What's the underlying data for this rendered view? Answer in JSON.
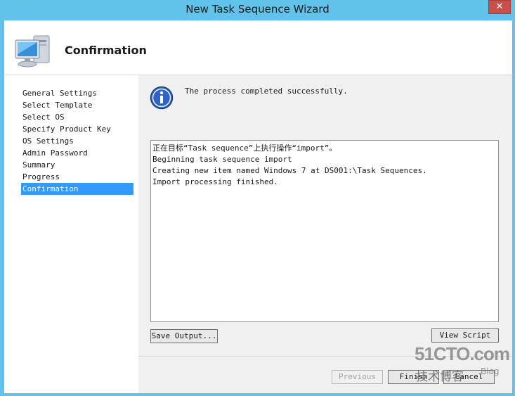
{
  "window": {
    "title": "New Task Sequence Wizard",
    "close_label": "✕"
  },
  "header": {
    "title": "Confirmation",
    "icon": "computer-icon"
  },
  "sidebar": {
    "items": [
      {
        "label": "General Settings",
        "selected": false
      },
      {
        "label": "Select Template",
        "selected": false
      },
      {
        "label": "Select OS",
        "selected": false
      },
      {
        "label": "Specify Product Key",
        "selected": false
      },
      {
        "label": "OS Settings",
        "selected": false
      },
      {
        "label": "Admin Password",
        "selected": false
      },
      {
        "label": "Summary",
        "selected": false
      },
      {
        "label": "Progress",
        "selected": false
      },
      {
        "label": "Confirmation",
        "selected": true
      }
    ]
  },
  "main": {
    "status_message": "The process completed successfully.",
    "status_icon": "info-icon",
    "log_lines": [
      "正在目标“Task sequence”上执行操作“import”。",
      "Beginning task sequence import",
      "Creating new item named Windows 7 at DS001:\\Task Sequences.",
      "Import processing finished."
    ],
    "save_output_label": "Save Output...",
    "view_script_label": "View Script"
  },
  "footer": {
    "previous_label": "Previous",
    "finish_label": "Finish",
    "cancel_label": "Cancel"
  },
  "watermark": {
    "main": "51CTO.com",
    "sub": "技术博客",
    "blog": "Blog"
  },
  "colors": {
    "frame": "#62c3ea",
    "selection": "#3399ff",
    "close": "#c7504b"
  }
}
